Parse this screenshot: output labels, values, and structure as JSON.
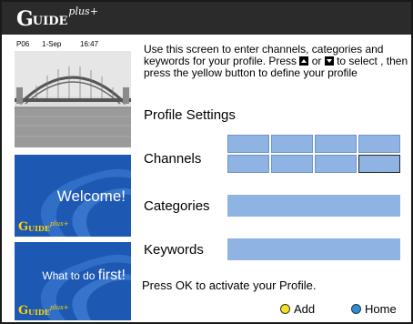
{
  "header": {
    "logo": {
      "g": "G",
      "uide": "UIDE",
      "plus": "plus+"
    }
  },
  "preview": {
    "channel": "P06",
    "date": "1-Sep",
    "time": "16:47",
    "lock_icon": "lock-icon"
  },
  "promos": [
    {
      "text": "Welcome!",
      "logo": {
        "g": "G",
        "uide": "UIDE",
        "plus": "plus+"
      }
    },
    {
      "text_small": "What to do ",
      "text_big": "first!",
      "logo": {
        "g": "G",
        "uide": "UIDE",
        "plus": "plus+"
      }
    }
  ],
  "main": {
    "instructions_1": "Use this screen to enter channels, categories and keywords for your profile.  Press ",
    "instructions_2": " or ",
    "instructions_3": " to select , then press the yellow button to define your profile",
    "up_key_icon": "up-arrow-key-icon",
    "down_key_icon": "down-arrow-key-icon",
    "section_title": "Profile Settings",
    "channels_label": "Channels",
    "categories_label": "Categories",
    "keywords_label": "Keywords",
    "ok_text": "Press OK to activate your Profile."
  },
  "legend": {
    "add_label": "Add",
    "add_color": "#f5e31a",
    "home_label": "Home",
    "home_color": "#2a8fd6"
  },
  "colors": {
    "topbar": "#2b2b2b",
    "promo_bg": "#1d58b3",
    "field_fill": "#8fb4e3"
  }
}
